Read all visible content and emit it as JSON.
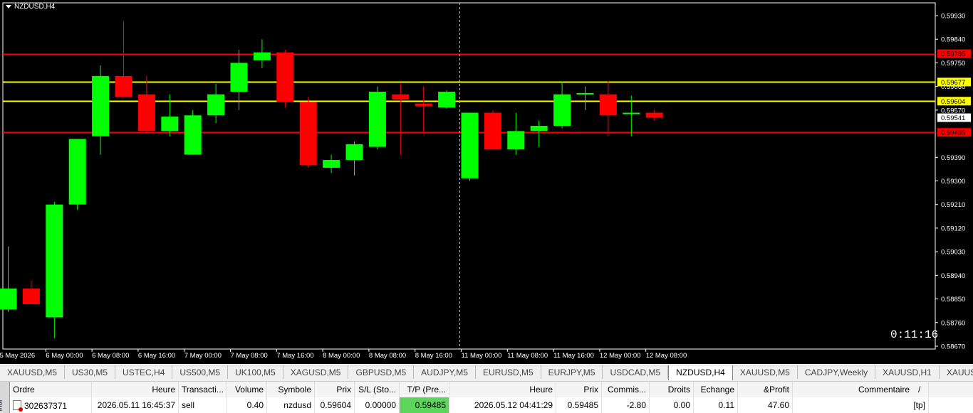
{
  "chart": {
    "title": "NZDUSD,H4",
    "timer": "0:11:16",
    "ymin": 0.5867,
    "ymax": 0.5993,
    "price_labels": [
      "0.59930",
      "0.59840",
      "0.59750",
      "0.59660",
      "0.59570",
      "0.59390",
      "0.59300",
      "0.59210",
      "0.59120",
      "0.59030",
      "0.58940",
      "0.58850",
      "0.58760",
      "0.58670"
    ],
    "price_values": [
      0.5993,
      0.5984,
      0.5975,
      0.5966,
      0.5957,
      0.5939,
      0.593,
      0.5921,
      0.5912,
      0.5903,
      0.5894,
      0.5885,
      0.5876,
      0.5867
    ],
    "hlines": [
      {
        "price": 0.59785,
        "label": "0.59785",
        "color": "#ff0000",
        "label_text_color": "#000000"
      },
      {
        "price": 0.59677,
        "label": "0.59677",
        "color": "#ffff00",
        "label_text_color": "#000000"
      },
      {
        "price": 0.59604,
        "label": "0.59604",
        "color": "#ffff00",
        "label_text_color": "#000000"
      },
      {
        "price": 0.59485,
        "label": "0.59485",
        "color": "#ff0000",
        "label_text_color": "#000000"
      }
    ],
    "current_price": {
      "price": 0.59541,
      "label": "0.59541"
    },
    "time_labels": [
      "5 May 2026",
      "6 May 00:00",
      "6 May 08:00",
      "6 May 16:00",
      "7 May 00:00",
      "7 May 08:00",
      "7 May 16:00",
      "8 May 00:00",
      "8 May 08:00",
      "8 May 16:00",
      "11 May 00:00",
      "11 May 08:00",
      "11 May 16:00",
      "12 May 00:00",
      "12 May 08:00"
    ],
    "time_label_candle_index": [
      0,
      2,
      4,
      6,
      8,
      10,
      12,
      14,
      16,
      18,
      20,
      22,
      24,
      26,
      28
    ],
    "candles": [
      {
        "o": 0.5881,
        "h": 0.5905,
        "l": 0.588,
        "c": 0.5889
      },
      {
        "o": 0.5889,
        "h": 0.5892,
        "l": 0.5883,
        "c": 0.5883
      },
      {
        "o": 0.5878,
        "h": 0.5922,
        "l": 0.587,
        "c": 0.5921
      },
      {
        "o": 0.5921,
        "h": 0.5946,
        "l": 0.5919,
        "c": 0.5946
      },
      {
        "o": 0.5947,
        "h": 0.5974,
        "l": 0.594,
        "c": 0.597
      },
      {
        "o": 0.597,
        "h": 0.5991,
        "l": 0.5962,
        "c": 0.5962
      },
      {
        "o": 0.5963,
        "h": 0.597,
        "l": 0.5948,
        "c": 0.5949
      },
      {
        "o": 0.5949,
        "h": 0.5963,
        "l": 0.5947,
        "c": 0.59545
      },
      {
        "o": 0.594,
        "h": 0.5957,
        "l": 0.594,
        "c": 0.5955
      },
      {
        "o": 0.5955,
        "h": 0.5967,
        "l": 0.5952,
        "c": 0.5963
      },
      {
        "o": 0.5964,
        "h": 0.598,
        "l": 0.5957,
        "c": 0.5975
      },
      {
        "o": 0.5976,
        "h": 0.5984,
        "l": 0.5973,
        "c": 0.5979
      },
      {
        "o": 0.5979,
        "h": 0.598,
        "l": 0.5958,
        "c": 0.596
      },
      {
        "o": 0.596,
        "h": 0.5962,
        "l": 0.5935,
        "c": 0.5936
      },
      {
        "o": 0.5935,
        "h": 0.594,
        "l": 0.5933,
        "c": 0.5938
      },
      {
        "o": 0.5938,
        "h": 0.5945,
        "l": 0.5932,
        "c": 0.5944
      },
      {
        "o": 0.5943,
        "h": 0.5966,
        "l": 0.5942,
        "c": 0.5964
      },
      {
        "o": 0.5963,
        "h": 0.5967,
        "l": 0.594,
        "c": 0.5961
      },
      {
        "o": 0.59595,
        "h": 0.5966,
        "l": 0.5948,
        "c": 0.59585
      },
      {
        "o": 0.5958,
        "h": 0.59645,
        "l": 0.59575,
        "c": 0.5964
      },
      {
        "o": 0.5931,
        "h": 0.5956,
        "l": 0.593,
        "c": 0.5956
      },
      {
        "o": 0.5956,
        "h": 0.5957,
        "l": 0.5942,
        "c": 0.5942
      },
      {
        "o": 0.5942,
        "h": 0.5956,
        "l": 0.594,
        "c": 0.5949
      },
      {
        "o": 0.5949,
        "h": 0.5953,
        "l": 0.5943,
        "c": 0.5951
      },
      {
        "o": 0.5951,
        "h": 0.5968,
        "l": 0.595,
        "c": 0.5963
      },
      {
        "o": 0.5963,
        "h": 0.5966,
        "l": 0.5957,
        "c": 0.59635
      },
      {
        "o": 0.5963,
        "h": 0.5968,
        "l": 0.5947,
        "c": 0.5955
      },
      {
        "o": 0.59555,
        "h": 0.59625,
        "l": 0.5947,
        "c": 0.5956
      },
      {
        "o": 0.5956,
        "h": 0.5957,
        "l": 0.5953,
        "c": 0.59541
      }
    ],
    "colors": {
      "bull": "#00ff00",
      "bear": "#ff0000",
      "grid_axis": "#ffffff",
      "vline": "#c0c0c0"
    },
    "vline_candle_index": 20
  },
  "tabs": [
    {
      "label": "XAUUSD,M5",
      "active": false
    },
    {
      "label": "US30,M5",
      "active": false
    },
    {
      "label": "USTEC,H4",
      "active": false
    },
    {
      "label": "US500,M5",
      "active": false
    },
    {
      "label": "UK100,M5",
      "active": false
    },
    {
      "label": "XAGUSD,M5",
      "active": false
    },
    {
      "label": "GBPUSD,M5",
      "active": false
    },
    {
      "label": "AUDJPY,M5",
      "active": false
    },
    {
      "label": "EURUSD,M5",
      "active": false
    },
    {
      "label": "EURJPY,M5",
      "active": false
    },
    {
      "label": "USDCAD,M5",
      "active": false
    },
    {
      "label": "NZDUSD,H4",
      "active": true
    },
    {
      "label": "XAUUSD,M5",
      "active": false
    },
    {
      "label": "CADJPY,Weekly",
      "active": false
    },
    {
      "label": "XAUUSD,H1",
      "active": false
    },
    {
      "label": "XAUUSD,\\",
      "active": false
    }
  ],
  "terminal": {
    "side_label": "inal",
    "headers": [
      "Ordre",
      "Heure",
      "Transacti...",
      "Volume",
      "Symbole",
      "Prix",
      "S/L (Sto...",
      "T/P (Pre...",
      "Heure",
      "Prix",
      "Commis...",
      "Droits",
      "Echange",
      "&Profit",
      "Commentaire"
    ],
    "sort_indicator": "/",
    "row": [
      "302637371",
      "2026.05.11 16:45:37",
      "sell",
      "0.40",
      "nzdusd",
      "0.59604",
      "0.00000",
      "0.59485",
      "2026.05.12 04:41:29",
      "0.59485",
      "-2.80",
      "0.00",
      "0.11",
      "47.60",
      "[tp]"
    ]
  }
}
